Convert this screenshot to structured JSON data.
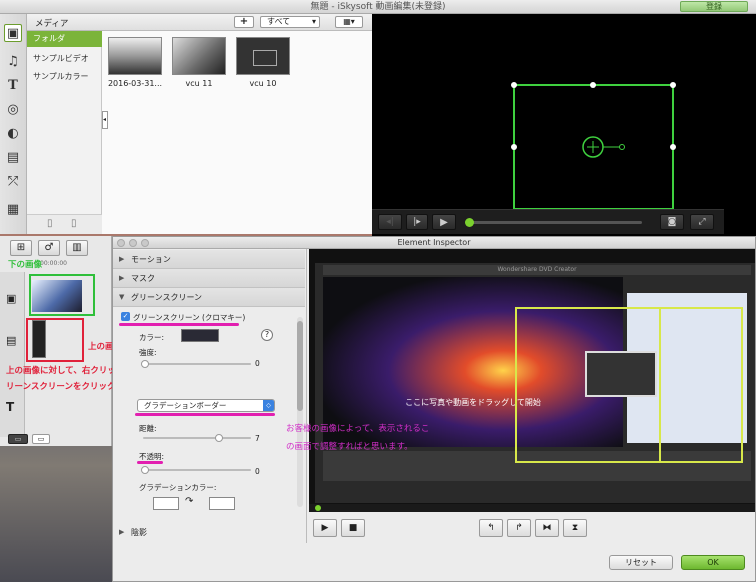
{
  "window": {
    "title": "無題 - iSkysoft 動画編集(未登録)",
    "register": "登録"
  },
  "media": {
    "header": "メディア",
    "add": "+",
    "filter": "すべて",
    "view": "▦▾"
  },
  "folders": [
    {
      "label": "フォルダ"
    },
    {
      "label": "サンプルビデオ"
    },
    {
      "label": "サンプルカラー"
    }
  ],
  "thumbs": [
    {
      "label": "2016-03-31..."
    },
    {
      "label": "vcu 11"
    },
    {
      "label": "vcu 10"
    }
  ],
  "inspector": {
    "title": "Element Inspector",
    "sections": {
      "motion": "モーション",
      "mask": "マスク",
      "green": "グリーンスクリーン",
      "shadow": "陰影"
    },
    "checkbox": "グリーンスクリーン (クロマキー)",
    "color_label": "カラー:",
    "strength_label": "強度:",
    "strength_value": "0",
    "mode": "グラデーションボーダー",
    "distance_label": "距離:",
    "distance_value": "7",
    "opacity_label": "不透明:",
    "opacity_value": "0",
    "gradient_label": "グラデーションカラー:",
    "help": "?",
    "reset": "リセット",
    "ok": "OK"
  },
  "viewer_text": {
    "drop": "ここに写真や動画をドラッグして開始",
    "app": "Wondershare DVD Creator"
  },
  "timeline": {
    "time": "00:00:00"
  },
  "annotations": {
    "lower": "下の画像",
    "upper": "上の画像",
    "instr1": "上の画像に対して、右クリック>グ",
    "instr2": "リーンスクリーンをクリックします。",
    "pink1": "お客様の画像によって、表示されるこ",
    "pink2": "の画面で調整すればと思います。"
  },
  "colors": {
    "accent": "#7bb43a",
    "green_frame": "#3fd13f",
    "annotation_red": "#e0213a",
    "annotation_pink": "#d12ec8"
  }
}
